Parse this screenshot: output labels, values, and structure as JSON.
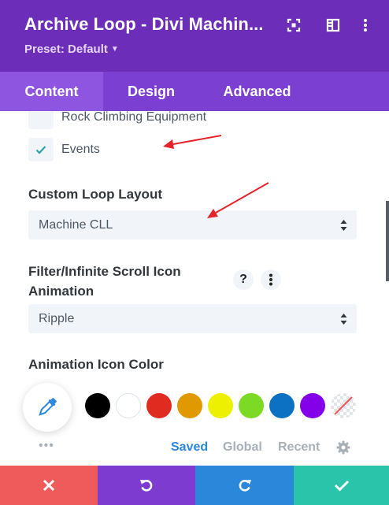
{
  "header": {
    "title": "Archive Loop - Divi Machin...",
    "preset_label": "Preset: Default",
    "icons": [
      "expand-icon",
      "sidebar-icon",
      "more-vertical-icon"
    ]
  },
  "tabs": [
    {
      "label": "Content",
      "active": true
    },
    {
      "label": "Design",
      "active": false
    },
    {
      "label": "Advanced",
      "active": false
    }
  ],
  "checkboxes": [
    {
      "label": "Rock Climbing Equipment",
      "checked": false
    },
    {
      "label": "Events",
      "checked": true
    }
  ],
  "custom_loop_layout": {
    "label": "Custom Loop Layout",
    "selected": "Machine CLL"
  },
  "filter_animation": {
    "label_line1": "Filter/Infinite Scroll Icon",
    "label_line2": "Animation",
    "help_icon": "?",
    "selected": "Ripple"
  },
  "animation_icon_color": {
    "label": "Animation Icon Color",
    "swatches": [
      "#000000",
      "#ffffff",
      "#e02b20",
      "#e09900",
      "#edf000",
      "#7cda24",
      "#0c71c3",
      "#8300e9",
      "transparent"
    ],
    "palette_tabs": [
      {
        "label": "Saved",
        "active": true
      },
      {
        "label": "Global",
        "active": false
      },
      {
        "label": "Recent",
        "active": false
      }
    ],
    "more_dots": "•••"
  },
  "colors": {
    "header_bg": "#6c2eb9",
    "tabs_bg": "#7b3fd1",
    "active_tab_bg": "#8e55e0",
    "accent_blue": "#2b87da",
    "annotation_arrow": "#e3242b",
    "footer_cancel": "#ef5a5a",
    "footer_undo": "#7e3bd0",
    "footer_redo": "#2b87da",
    "footer_save": "#29c4a9"
  },
  "footer": {
    "buttons": [
      "close-icon",
      "undo-icon",
      "redo-icon",
      "check-icon"
    ]
  }
}
